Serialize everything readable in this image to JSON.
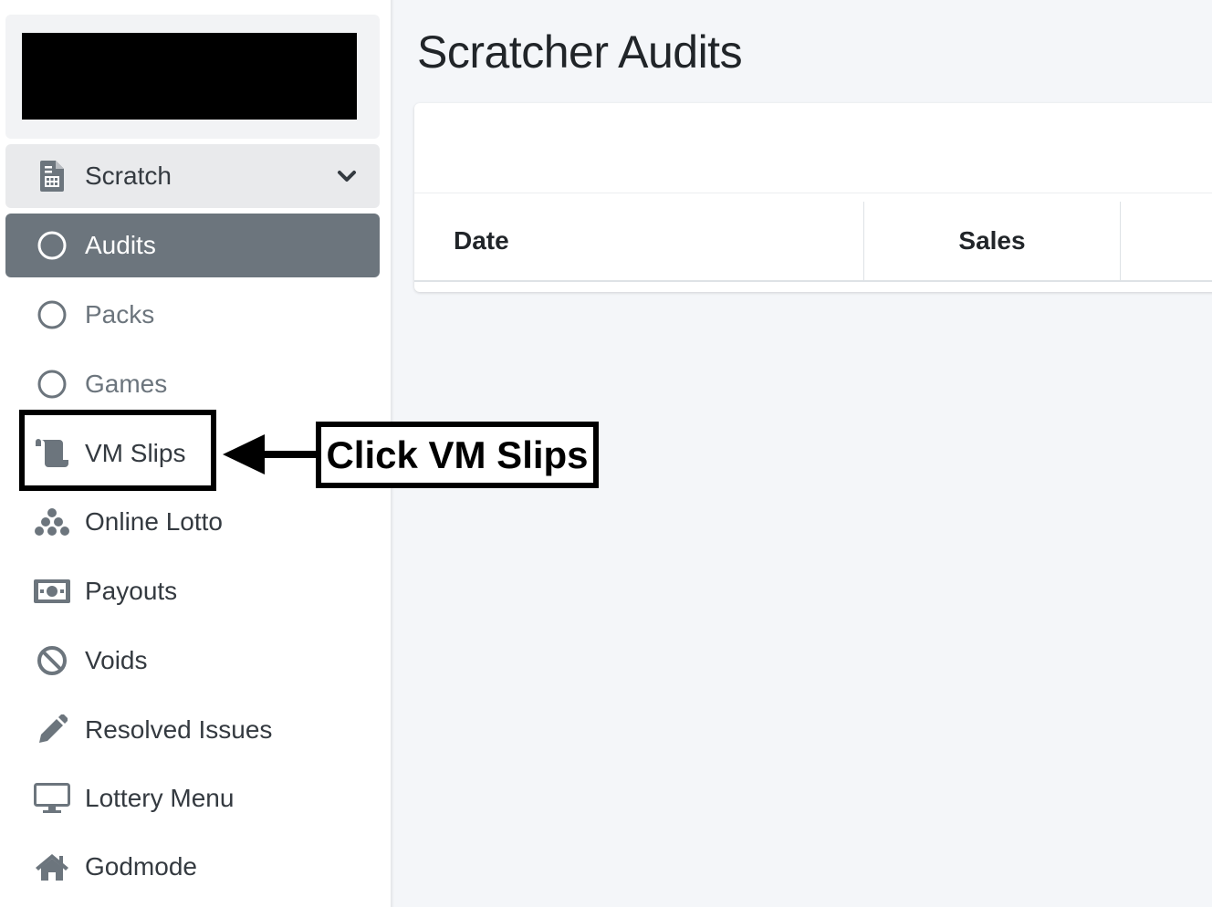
{
  "sidebar": {
    "brand": {
      "logo": "redacted logo"
    },
    "parent_item": {
      "label": "Scratch",
      "icon": "file-invoice-icon",
      "expanded": true
    },
    "items": [
      {
        "label": "Audits",
        "icon": "circle-outline-icon",
        "active": true
      },
      {
        "label": "Packs",
        "icon": "circle-outline-icon"
      },
      {
        "label": "Games",
        "icon": "circle-outline-icon"
      },
      {
        "label": "VM Slips",
        "icon": "scroll-icon"
      },
      {
        "label": "Online Lotto",
        "icon": "balls-icon"
      },
      {
        "label": "Payouts",
        "icon": "money-bill-icon"
      },
      {
        "label": "Voids",
        "icon": "ban-icon"
      },
      {
        "label": "Resolved Issues",
        "icon": "pencil-icon"
      },
      {
        "label": "Lottery Menu",
        "icon": "desktop-icon"
      },
      {
        "label": "Godmode",
        "icon": "home-icon"
      }
    ]
  },
  "main": {
    "title": "Scratcher Audits",
    "table": {
      "columns": [
        "Date",
        "Sales"
      ]
    }
  },
  "annotation": {
    "text": "Click VM Slips",
    "target": "VM Slips"
  },
  "colors": {
    "active_bg": "#6c757d",
    "parent_bg": "#e9eaec",
    "page_bg": "#f4f6f9"
  }
}
